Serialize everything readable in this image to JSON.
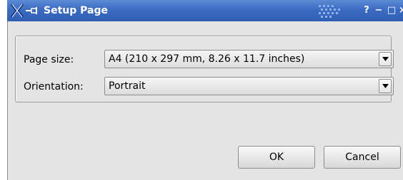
{
  "window": {
    "title": "Setup Page",
    "buttons": {
      "help": "?",
      "minimize": "−",
      "maximize": "□",
      "close": "×"
    }
  },
  "form": {
    "page_size": {
      "label": "Page size:",
      "value": "A4 (210 x 297 mm, 8.26 x 11.7 inches)"
    },
    "orientation": {
      "label": "Orientation:",
      "value": "Portrait"
    }
  },
  "actions": {
    "ok": "OK",
    "cancel": "Cancel"
  },
  "colors": {
    "titlebar": "#3c6cc2",
    "dialog_background": "#e4e4e4"
  },
  "icons": {
    "app": "x-window-icon",
    "pin": "pin-icon",
    "dropdown": "triangle-down-icon"
  }
}
